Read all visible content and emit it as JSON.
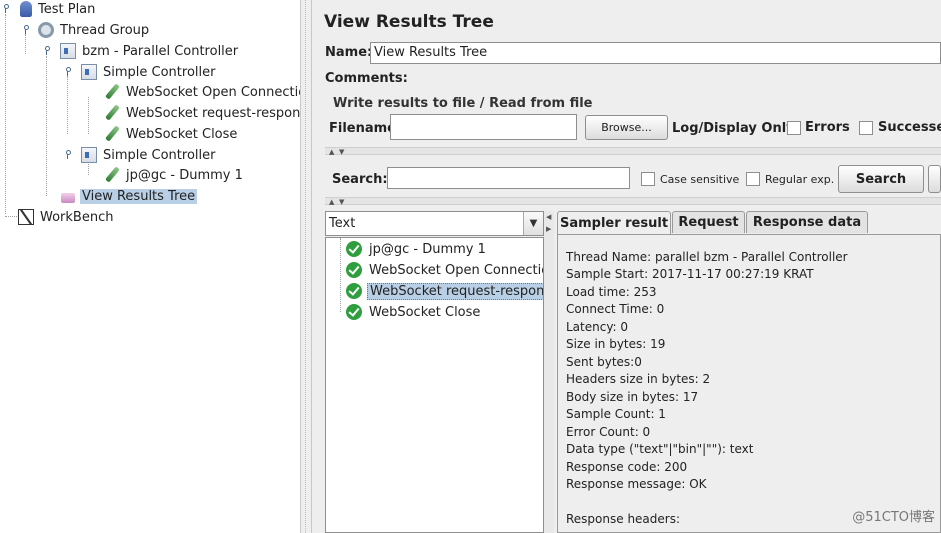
{
  "tree": {
    "nodes": [
      {
        "label": "Test Plan",
        "icon": "test-plan-icon"
      },
      {
        "label": "Thread Group",
        "icon": "thread-group-gear-icon"
      },
      {
        "label": "bzm - Parallel Controller",
        "icon": "controller-icon"
      },
      {
        "label": "Simple Controller",
        "icon": "controller-icon"
      },
      {
        "label": "WebSocket Open Connection",
        "icon": "sampler-pen-icon"
      },
      {
        "label": "WebSocket request-respons",
        "icon": "sampler-pen-icon"
      },
      {
        "label": "WebSocket Close",
        "icon": "sampler-pen-icon"
      },
      {
        "label": "Simple Controller",
        "icon": "controller-icon"
      },
      {
        "label": "jp@gc - Dummy 1",
        "icon": "sampler-pen-icon"
      },
      {
        "label": "View Results Tree",
        "icon": "listener-icon"
      },
      {
        "label": "WorkBench",
        "icon": "workbench-icon"
      }
    ]
  },
  "panel": {
    "title": "View Results Tree",
    "name_label": "Name:",
    "name_value": "View Results Tree",
    "comments_label": "Comments:",
    "file_group_title": "Write results to file / Read from file",
    "filename_label": "Filename",
    "filename_value": "",
    "browse_label": "Browse...",
    "log_display_label": "Log/Display Only:",
    "errors_label": "Errors",
    "successes_label": "Successes"
  },
  "search": {
    "label": "Search:",
    "value": "",
    "case_sensitive_label": "Case sensitive",
    "regular_exp_label": "Regular exp.",
    "search_button_label": "Search"
  },
  "results": {
    "renderer_value": "Text",
    "items": [
      {
        "label": "jp@gc - Dummy 1"
      },
      {
        "label": "WebSocket Open Connectio"
      },
      {
        "label": "WebSocket request-respons"
      },
      {
        "label": "WebSocket Close"
      }
    ],
    "selected_index": 2
  },
  "tabs": {
    "sampler_result": "Sampler result",
    "request": "Request",
    "response_data": "Response data"
  },
  "sampler_result": {
    "lines": [
      "Thread Name: parallel bzm - Parallel Controller",
      "Sample Start: 2017-11-17 00:27:19 KRAT",
      "Load time: 253",
      "Connect Time: 0",
      "Latency: 0",
      "Size in bytes: 19",
      "Sent bytes:0",
      "Headers size in bytes: 2",
      "Body size in bytes: 17",
      "Sample Count: 1",
      "Error Count: 0",
      "Data type (\"text\"|\"bin\"|\"\"): text",
      "Response code: 200",
      "Response message: OK",
      "",
      "Response headers:"
    ]
  },
  "watermark": "@51CTO博客"
}
